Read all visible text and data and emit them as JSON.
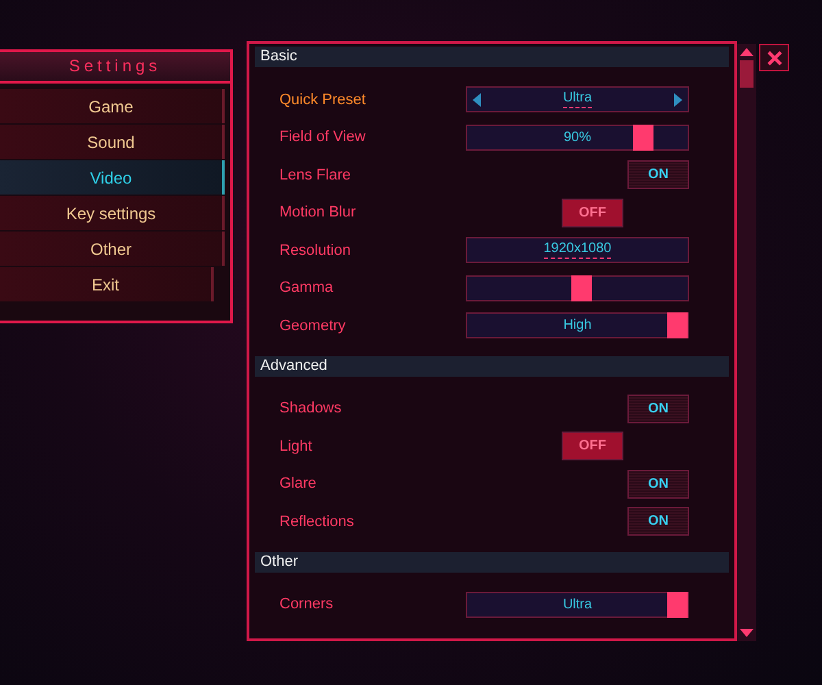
{
  "menu": {
    "title": "Settings",
    "items": [
      {
        "label": "Game",
        "selected": false
      },
      {
        "label": "Sound",
        "selected": false
      },
      {
        "label": "Video",
        "selected": true
      },
      {
        "label": "Key settings",
        "selected": false
      },
      {
        "label": "Other",
        "selected": false
      },
      {
        "label": "Exit",
        "selected": false
      }
    ]
  },
  "sections": [
    {
      "title": "Basic",
      "rows": [
        {
          "label": "Quick Preset",
          "selected": true,
          "kind": "selector",
          "value": "Ultra"
        },
        {
          "label": "Field of View",
          "selected": false,
          "kind": "slider",
          "value": "90%",
          "level": 0.83
        },
        {
          "label": "Lens Flare",
          "selected": false,
          "kind": "toggle",
          "on": true,
          "value": "ON"
        },
        {
          "label": "Motion Blur",
          "selected": false,
          "kind": "toggle",
          "on": false,
          "value": "OFF"
        },
        {
          "label": "Resolution",
          "selected": false,
          "kind": "dropdown",
          "value": "1920x1080"
        },
        {
          "label": "Gamma",
          "selected": false,
          "kind": "slider",
          "level": 0.52
        },
        {
          "label": "Geometry",
          "selected": false,
          "kind": "slider",
          "value": "High",
          "level": 1
        }
      ]
    },
    {
      "title": "Advanced",
      "rows": [
        {
          "label": "Shadows",
          "selected": false,
          "kind": "toggle",
          "on": true,
          "value": "ON"
        },
        {
          "label": "Light",
          "selected": false,
          "kind": "toggle",
          "on": false,
          "value": "OFF"
        },
        {
          "label": "Glare",
          "selected": false,
          "kind": "toggle",
          "on": true,
          "value": "ON"
        },
        {
          "label": "Reflections",
          "selected": false,
          "kind": "toggle",
          "on": true,
          "value": "ON"
        }
      ]
    },
    {
      "title": "Other",
      "rows": [
        {
          "label": "Corners",
          "selected": false,
          "kind": "slider",
          "value": "Ultra",
          "level": 1
        }
      ]
    }
  ]
}
